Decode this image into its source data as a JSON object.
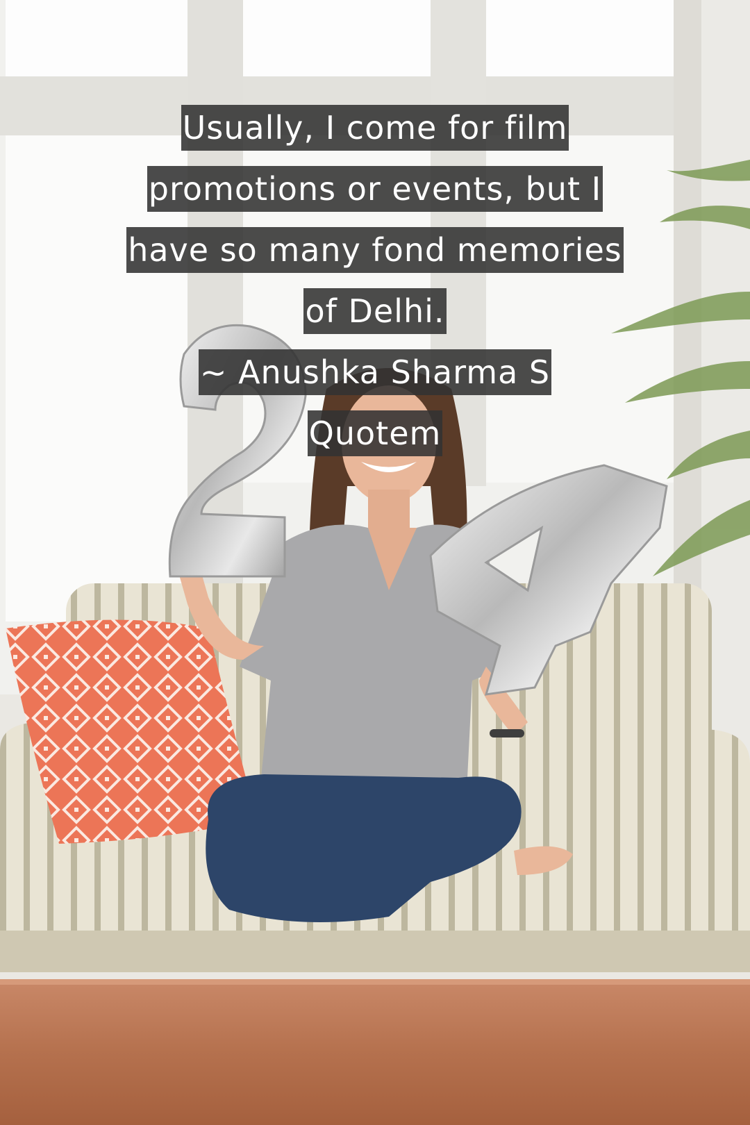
{
  "quote": {
    "lines": [
      "Usually, I come for film",
      "promotions or events, but I",
      "have so many fond memories",
      "of Delhi.",
      "~ Anushka Sharma S",
      "Quotem"
    ]
  },
  "photo": {
    "subject": "woman on striped sofa holding number balloons",
    "balloon_digits": [
      "2",
      "4"
    ]
  },
  "colors": {
    "caption_background": "#323232",
    "caption_text": "#ffffff",
    "pillow_accent": "#ec7557",
    "table": "#b5714e"
  }
}
